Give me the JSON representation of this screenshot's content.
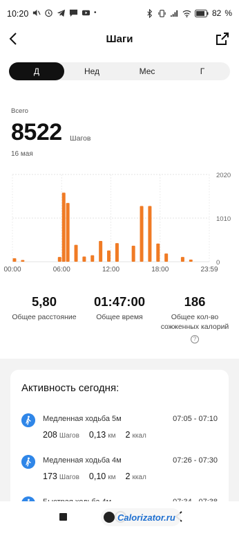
{
  "status_bar": {
    "time": "10:20",
    "battery": "82"
  },
  "header": {
    "title": "Шаги"
  },
  "tabs": [
    {
      "label": "Д",
      "active": true
    },
    {
      "label": "Нед",
      "active": false
    },
    {
      "label": "Мес",
      "active": false
    },
    {
      "label": "Г",
      "active": false
    }
  ],
  "summary": {
    "label": "Всего",
    "value": "8522",
    "unit": "Шагов",
    "date": "16 мая"
  },
  "chart_data": {
    "type": "bar",
    "bar_color": "#f07b25",
    "x_ticks": [
      "00:00",
      "06:00",
      "12:00",
      "18:00",
      "23:59"
    ],
    "y_ticks": [
      "2020",
      "1010",
      "0"
    ],
    "ylim": [
      0,
      2020
    ],
    "values": [
      {
        "h": 0.25,
        "v": 80
      },
      {
        "h": 1.25,
        "v": 40
      },
      {
        "h": 5.75,
        "v": 110
      },
      {
        "h": 6.25,
        "v": 1600
      },
      {
        "h": 6.75,
        "v": 1360
      },
      {
        "h": 7.75,
        "v": 390
      },
      {
        "h": 8.75,
        "v": 120
      },
      {
        "h": 9.75,
        "v": 150
      },
      {
        "h": 10.75,
        "v": 480
      },
      {
        "h": 11.75,
        "v": 260
      },
      {
        "h": 12.75,
        "v": 430
      },
      {
        "h": 14.75,
        "v": 370
      },
      {
        "h": 15.75,
        "v": 1290
      },
      {
        "h": 16.75,
        "v": 1290
      },
      {
        "h": 17.75,
        "v": 420
      },
      {
        "h": 18.75,
        "v": 190
      },
      {
        "h": 20.75,
        "v": 110
      },
      {
        "h": 21.75,
        "v": 50
      }
    ]
  },
  "stats": [
    {
      "value": "5,80",
      "label": "Общее расстояние"
    },
    {
      "value": "01:47:00",
      "label": "Общее время"
    },
    {
      "value": "186",
      "label": "Общее кол-во сожженных калорий"
    }
  ],
  "activity": {
    "title": "Активность сегодня:",
    "items": [
      {
        "name": "Медленная ходьба 5м",
        "range": "07:05 - 07:10",
        "steps": "208",
        "steps_unit": "Шагов",
        "distance": "0,13",
        "distance_unit": "км",
        "kcal": "2",
        "kcal_unit": "ккал"
      },
      {
        "name": "Медленная ходьба 4м",
        "range": "07:26 - 07:30",
        "steps": "173",
        "steps_unit": "Шагов",
        "distance": "0,10",
        "distance_unit": "км",
        "kcal": "2",
        "kcal_unit": "ккал"
      },
      {
        "name": "Быстрая ходьба 4м",
        "range": "07:34 - 07:38"
      }
    ]
  },
  "watermark": {
    "text": "Calorizator.ru"
  }
}
